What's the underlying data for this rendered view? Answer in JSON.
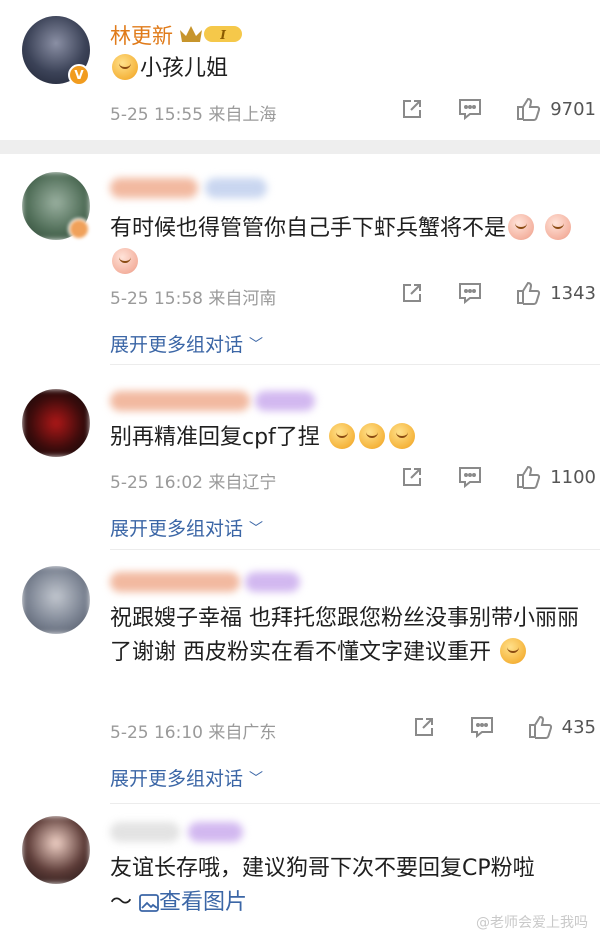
{
  "post": {
    "author": "林更新",
    "text": "小孩儿姐",
    "time": "5-25 15:55",
    "location": "来自上海",
    "likes": "9701"
  },
  "comments": [
    {
      "text": "有时候也得管管你自己手下虾兵蟹将不是",
      "time": "5-25 15:58",
      "location": "来自河南",
      "likes": "1343",
      "expand": "展开更多组对话"
    },
    {
      "text": "别再精准回复cpf了捏",
      "time": "5-25 16:02",
      "location": "来自辽宁",
      "likes": "1100",
      "expand": "展开更多组对话"
    },
    {
      "text": "祝跟嫂子幸福 也拜托您跟您粉丝没事别带小丽丽了谢谢 西皮粉实在看不懂文字建议重开",
      "time": "5-25 16:10",
      "location": "来自广东",
      "likes": "435",
      "expand": "展开更多组对话"
    },
    {
      "text": "友谊长存哦，建议狗哥下次不要回复CP粉啦",
      "tail": "～",
      "image_link": "查看图片"
    }
  ],
  "badge_letter": "V",
  "watermark": "@老师会爱上我吗",
  "colors": {
    "name": "#e07b1a",
    "link": "#3b66a6",
    "meta": "#9a9a9a"
  },
  "icons": [
    "share-icon",
    "comment-icon",
    "like-icon",
    "chevron-down-icon",
    "image-icon",
    "crown-badge-icon"
  ]
}
